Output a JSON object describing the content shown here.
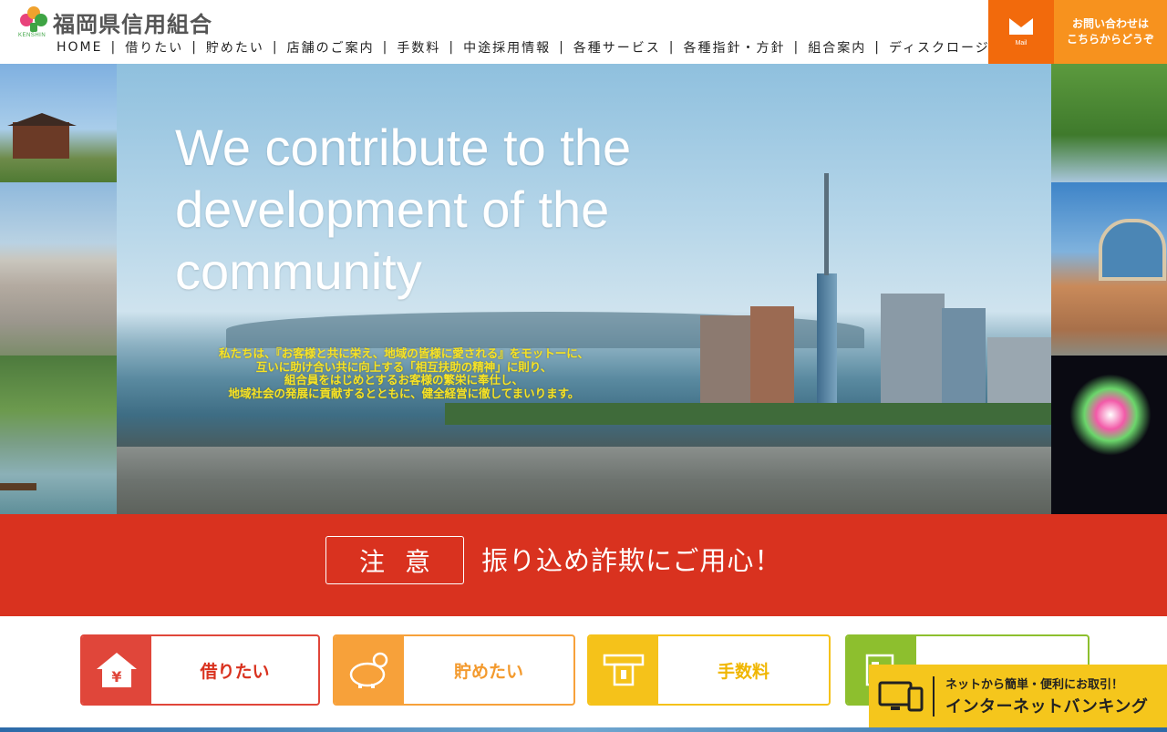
{
  "header": {
    "logo_text": "福岡県信用組合",
    "logo_sub": "KENSHIN",
    "nav": [
      "HOME",
      "借りたい",
      "貯めたい",
      "店舗のご案内",
      "手数料",
      "中途採用情報",
      "各種サービス",
      "各種指針・方針",
      "組合案内",
      "ディスクロージャー"
    ],
    "nav_separator": "|",
    "mail_label": "Mail",
    "contact_label": [
      "お問い合わせは",
      "こちらからどうぞ"
    ]
  },
  "hero": {
    "title": "We contribute to the development of the community",
    "message_lines": [
      "私たちは、『お客様と共に栄え、地域の皆様に愛される』をモットーに、",
      "互いに助け合い共に向上する「相互扶助の精神」に則り、",
      "組合員をはじめとするお客様の繁栄に奉仕し、",
      "地域社会の発展に貢献するとともに、健全経営に徹してまいります。"
    ]
  },
  "warning": {
    "badge": "注意",
    "text": "振り込め詐欺にご用心！"
  },
  "services": {
    "borrow": "借りたい",
    "save": "貯めたい",
    "fee": "手数料"
  },
  "internet_banking": {
    "line1": "ネットから簡単・便利にお取引！",
    "line2": "インターネットバンキング"
  },
  "colors": {
    "accent_orange": "#f26a0c",
    "warning_red": "#d9321f",
    "banking_yellow": "#f5c61c"
  }
}
